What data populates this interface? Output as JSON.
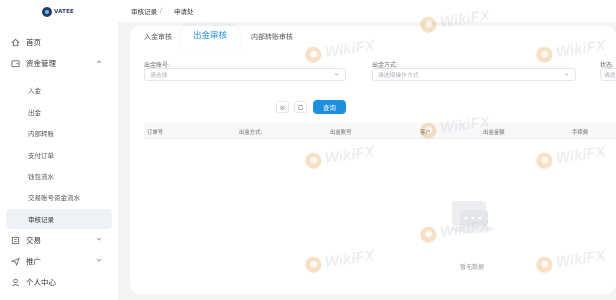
{
  "logo": {
    "text": "VATEE"
  },
  "sidebar": {
    "home": "首页",
    "fund_management": "资金管理",
    "sub_items": [
      "入金",
      "出金",
      "内部转账",
      "支付订单",
      "钱包流水",
      "交易账号资金流水",
      "审核记录"
    ],
    "trading": "交易",
    "promotion": "推广",
    "personal_center": "个人中心"
  },
  "breadcrumb": {
    "first": "审核记录",
    "separator": "/",
    "second": "申请处"
  },
  "tabs": [
    "入金审核",
    "出金审核",
    "内部转账审核"
  ],
  "filters": {
    "account_label": "出金账号:",
    "account_placeholder": "请选择",
    "method_label": "出金方式:",
    "method_placeholder": "请选择操作方式",
    "status_label": "状态:",
    "status_placeholder": "请选"
  },
  "search_button": "查询",
  "table": {
    "columns": [
      "订单号",
      "出金方式:",
      "出金账号",
      "客户",
      "出金金额",
      "手续费"
    ]
  },
  "empty_text": "暂无数据",
  "watermark": "WikiFX",
  "colors": {
    "accent": "#1d8fe0",
    "brand": "#2b3a67",
    "watermark": "#e8a24c"
  }
}
